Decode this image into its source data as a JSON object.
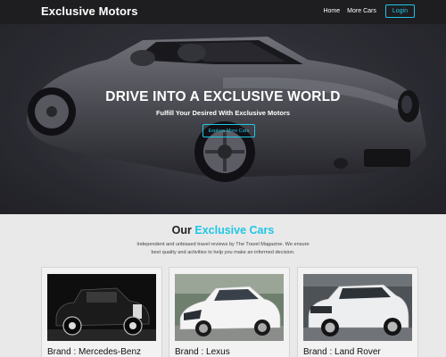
{
  "navbar": {
    "brand": "Exclusive Motors",
    "links": [
      "Home",
      "More Cars"
    ],
    "login_label": "Login"
  },
  "hero": {
    "title": "DRIVE INTO A EXCLUSIVE WORLD",
    "subtitle": "Fulfill Your Desired With Exclusive Motors",
    "button_label": "Explore More Cars"
  },
  "section": {
    "title_prefix": "Our ",
    "title_accent": "Exclusive Cars",
    "description": "Independent and unbiased travel reviews by The Travel Magazine. We ensure best quality and activities to help you make an informed decision."
  },
  "cards": [
    {
      "label": "Brand : Mercedes-Benz"
    },
    {
      "label": "Brand : Lexus"
    },
    {
      "label": "Brand : Land Rover"
    }
  ],
  "colors": {
    "accent": "#1ec6e6",
    "navbar_bg": "#1e1e20",
    "page_bg": "#e9e9e9"
  }
}
